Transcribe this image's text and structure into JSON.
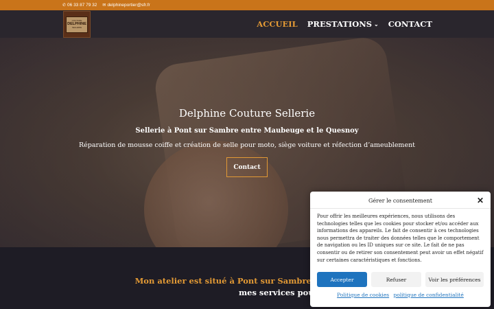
{
  "topbar": {
    "phone": "06 33 87 79 32",
    "email": "delphineportier@sfr.fr",
    "phone_icon": "phone-icon",
    "email_icon": "envelope-icon"
  },
  "logo": {
    "line1": "COUTURE",
    "line2": "DELPHINE",
    "line3": "SELLERIE"
  },
  "nav": {
    "items": [
      {
        "label": "ACCUEIL",
        "active": true
      },
      {
        "label": "PRESTATIONS",
        "has_dropdown": true,
        "dropdown_icon": "chevron-down-icon"
      },
      {
        "label": "CONTACT"
      }
    ]
  },
  "hero": {
    "title": "Delphine Couture Sellerie",
    "subtitle": "Sellerie à Pont sur Sambre entre Maubeuge et le Quesnoy",
    "description": "Réparation de mousse coiffe et création de selle pour moto,  siège voiture et réfection  d’ameublement",
    "cta": "Contact"
  },
  "section": {
    "line1": "Mon atelier est situé à Pont sur Sambre entre Maubeuge, Le Ques",
    "line2": "mes services pour :"
  },
  "consent": {
    "title": "Gérer le consentement",
    "close_icon": "close-icon",
    "text": "Pour offrir les meilleures expériences, nous utilisons des technologies telles que les cookies pour stocker et/ou accéder aux informations des appareils. Le fait de consentir à ces technologies nous permettra de traiter des données telles que le comportement de navigation ou les ID uniques sur ce site. Le fait de ne pas consentir ou de retirer son consentement peut avoir un effet négatif sur certaines caractéristiques et fonctions.",
    "accept": "Accepter",
    "refuse": "Refuser",
    "preferences": "Voir les préférences",
    "cookie_policy": "Politique de cookies",
    "privacy_policy": "politique de confidentialité"
  },
  "colors": {
    "accent": "#e39a35",
    "topbar": "#c9741a",
    "button": "#1e73be",
    "dark_bg": "#1e1c25"
  }
}
